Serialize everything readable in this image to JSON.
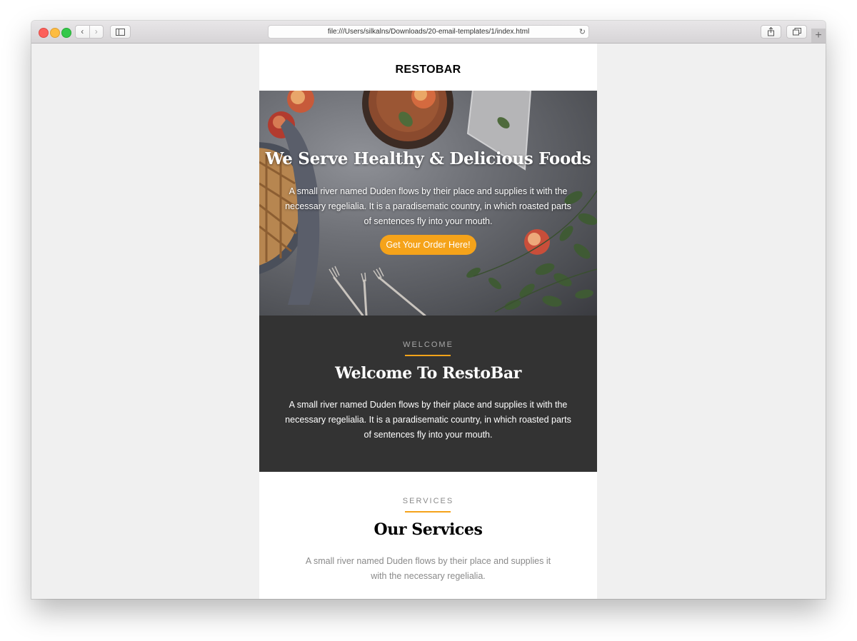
{
  "browser": {
    "url": "file:///Users/silkalns/Downloads/20-email-templates/1/index.html",
    "back_icon": "chevron-left-icon",
    "forward_icon": "chevron-right-icon",
    "sidebar_icon": "sidebar-icon",
    "reload_icon": "reload-icon",
    "share_icon": "share-icon",
    "tabs_icon": "tabs-icon",
    "new_tab_icon": "plus-icon",
    "new_tab_label": "+"
  },
  "email": {
    "brand": "RESTOBAR",
    "hero": {
      "title": "We Serve Healthy & Delicious Foods",
      "text": "A small river named Duden flows by their place and supplies it with the necessary regelialia. It is a paradisematic country, in which roasted parts of sentences fly into your mouth.",
      "cta_label": "Get Your Order Here!"
    },
    "welcome": {
      "eyebrow": "WELCOME",
      "heading": "Welcome To RestoBar",
      "text": "A small river named Duden flows by their place and supplies it with the necessary regelialia. It is a paradisematic country, in which roasted parts of sentences fly into your mouth."
    },
    "services": {
      "eyebrow": "SERVICES",
      "heading": "Our Services",
      "text": "A small river named Duden flows by their place and supplies it with the necessary regelialia."
    }
  },
  "colors": {
    "accent": "#f5a31a",
    "dark_section": "#333333",
    "page_background": "#f0f0f0"
  }
}
